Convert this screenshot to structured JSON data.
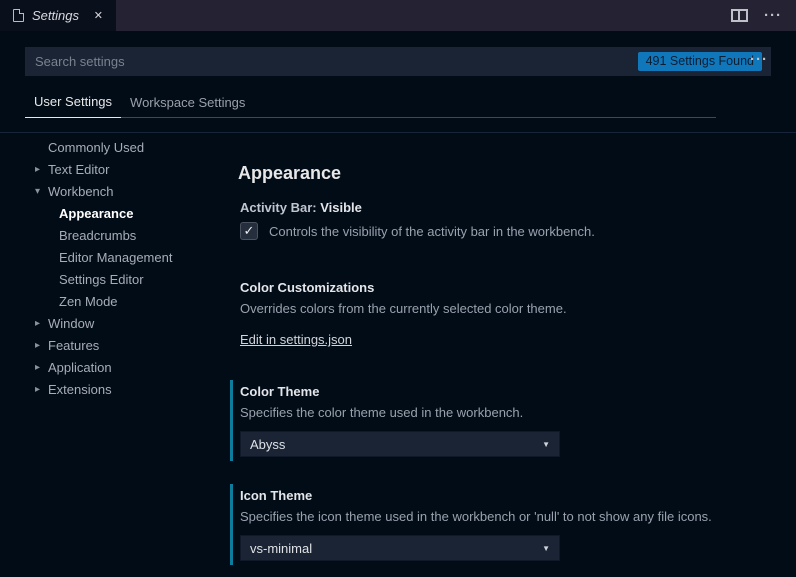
{
  "colors": {
    "badge_bg": "#1177bb",
    "modified_indicator": "#0c7d9d",
    "tab_strip_bg": "#252233",
    "editor_bg": "#020c17"
  },
  "icons": {
    "close": "✕",
    "check": "✓",
    "dropdown_arrow": "▼",
    "more": "···",
    "collapsed": "▸",
    "expanded": "▾"
  },
  "tab_bar": {
    "tab_label": "Settings"
  },
  "header": {
    "search": {
      "placeholder": "Search settings",
      "badge": "491 Settings Found"
    },
    "scope_tabs": [
      {
        "label": "User Settings",
        "active": true
      },
      {
        "label": "Workspace Settings",
        "active": false
      }
    ]
  },
  "tree": {
    "items": [
      {
        "label": "Commonly Used",
        "level": 1,
        "twistie": "none",
        "selected": false
      },
      {
        "label": "Text Editor",
        "level": 1,
        "twistie": "collapsed",
        "selected": false
      },
      {
        "label": "Workbench",
        "level": 1,
        "twistie": "expanded",
        "selected": false
      },
      {
        "label": "Appearance",
        "level": 2,
        "twistie": "none",
        "selected": true
      },
      {
        "label": "Breadcrumbs",
        "level": 2,
        "twistie": "none",
        "selected": false
      },
      {
        "label": "Editor Management",
        "level": 2,
        "twistie": "none",
        "selected": false
      },
      {
        "label": "Settings Editor",
        "level": 2,
        "twistie": "none",
        "selected": false
      },
      {
        "label": "Zen Mode",
        "level": 2,
        "twistie": "none",
        "selected": false
      },
      {
        "label": "Window",
        "level": 1,
        "twistie": "collapsed",
        "selected": false
      },
      {
        "label": "Features",
        "level": 1,
        "twistie": "collapsed",
        "selected": false
      },
      {
        "label": "Application",
        "level": 1,
        "twistie": "collapsed",
        "selected": false
      },
      {
        "label": "Extensions",
        "level": 1,
        "twistie": "collapsed",
        "selected": false
      }
    ]
  },
  "content": {
    "page_title": "Appearance",
    "settings": [
      {
        "category": "Activity Bar:",
        "name": "Visible",
        "type": "checkbox",
        "checked": true,
        "description": "Controls the visibility of the activity bar in the workbench.",
        "modified": false
      },
      {
        "name": "Color Customizations",
        "type": "link",
        "description": "Overrides colors from the currently selected color theme.",
        "link_label": "Edit in settings.json",
        "modified": false
      },
      {
        "name": "Color Theme",
        "type": "select",
        "description": "Specifies the color theme used in the workbench.",
        "value": "Abyss",
        "modified": true
      },
      {
        "name": "Icon Theme",
        "type": "select",
        "description": "Specifies the icon theme used in the workbench or 'null' to not show any file icons.",
        "value": "vs-minimal",
        "modified": true
      }
    ]
  }
}
